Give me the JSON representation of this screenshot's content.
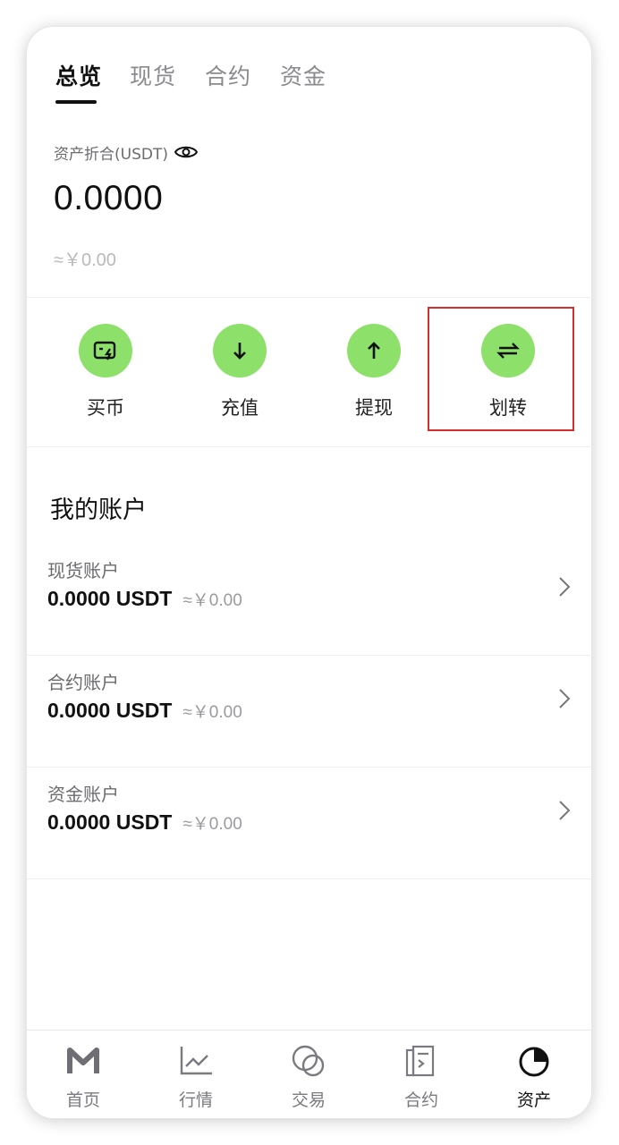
{
  "tabs": [
    {
      "label": "总览",
      "active": true
    },
    {
      "label": "现货",
      "active": false
    },
    {
      "label": "合约",
      "active": false
    },
    {
      "label": "资金",
      "active": false
    }
  ],
  "overview": {
    "label": "资产折合(USDT)",
    "amount": "0.0000",
    "cny": "≈￥0.00",
    "visibility_icon": "eye-icon"
  },
  "actions": [
    {
      "label": "买币",
      "icon": "buy-card-icon"
    },
    {
      "label": "充值",
      "icon": "arrow-down-icon"
    },
    {
      "label": "提现",
      "icon": "arrow-up-icon"
    },
    {
      "label": "划转",
      "icon": "transfer-arrows-icon",
      "highlighted": true
    }
  ],
  "accounts_title": "我的账户",
  "accounts": [
    {
      "name": "现货账户",
      "amount": "0.0000 USDT",
      "cny": "≈￥0.00"
    },
    {
      "name": "合约账户",
      "amount": "0.0000 USDT",
      "cny": "≈￥0.00"
    },
    {
      "name": "资金账户",
      "amount": "0.0000 USDT",
      "cny": "≈￥0.00"
    }
  ],
  "bottom_nav": [
    {
      "label": "首页",
      "icon": "m-logo-icon",
      "active": false
    },
    {
      "label": "行情",
      "icon": "chart-line-icon",
      "active": false
    },
    {
      "label": "交易",
      "icon": "exchange-circles-icon",
      "active": false
    },
    {
      "label": "合约",
      "icon": "contract-doc-icon",
      "active": false
    },
    {
      "label": "资产",
      "icon": "pie-chart-icon",
      "active": true
    }
  ],
  "colors": {
    "accent_green": "#8de06a",
    "highlight_red": "#d62d2d",
    "text_primary": "#111111",
    "text_secondary": "#8a8a8f"
  }
}
